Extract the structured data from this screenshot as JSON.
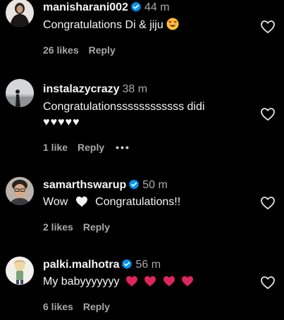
{
  "comments": [
    {
      "username": "manisharani002",
      "verified": true,
      "time": "44 m",
      "text": "Congratulations Di & jiju",
      "text_emoji": "heart-eyes-face",
      "likes": "26 likes",
      "reply": "Reply"
    },
    {
      "username": "instalazycrazy",
      "verified": false,
      "time": "38 m",
      "text": "Congratulationssssssssssss didi",
      "text_line2": "♥♥♥♥♥",
      "likes": "1 like",
      "reply": "Reply",
      "more": "•••"
    },
    {
      "username": "samarthswarup",
      "verified": true,
      "time": "50 m",
      "text_before": "Wow",
      "text_emoji": "white-heart",
      "text_after": "Congratulations!!",
      "likes": "2 likes",
      "reply": "Reply"
    },
    {
      "username": "palki.malhotra",
      "verified": true,
      "time": "56 m",
      "text": "My babyyyyyyy",
      "text_emoji": "red-heart x4",
      "likes": "6 likes",
      "reply": "Reply"
    }
  ],
  "colors": {
    "background": "#000000",
    "text": "#f5f5f5",
    "secondary": "#a8a8a8",
    "verified_blue": "#0095f6",
    "red_heart": "#e0245e"
  }
}
